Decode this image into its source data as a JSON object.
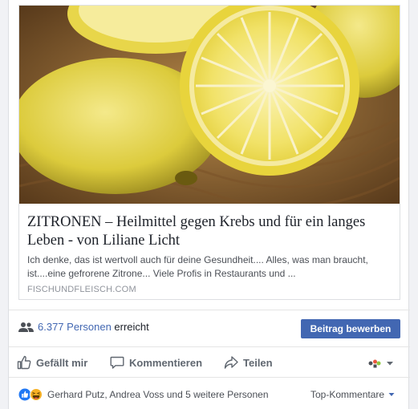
{
  "link_preview": {
    "title": "ZITRONEN – Heilmittel gegen Krebs und für ein langes Leben - von Liliane Licht",
    "description": "Ich denke, das ist wertvoll auch für deine Gesundheit.... Alles, was man braucht, ist....eine gefrorene Zitrone... Viele Profis in Restaurants und ...",
    "domain": "FISCHUNDFLEISCH.COM"
  },
  "reach": {
    "count": "6.377 Personen",
    "suffix": " erreicht",
    "promote_label": "Beitrag bewerben"
  },
  "actions": {
    "like": "Gefällt mir",
    "comment": "Kommentieren",
    "share": "Teilen"
  },
  "likes": {
    "names": "Gerhard Putz, Andrea Voss und 5 weitere Personen",
    "sort_label": "Top-Kommentare"
  },
  "colors": {
    "brand": "#4267b2",
    "like_blue": "#2078f4",
    "haha_yellow": "#f7b125"
  },
  "icons": [
    "people-icon",
    "like-icon",
    "comment-icon",
    "share-icon",
    "audience-icon",
    "chevron-down-icon",
    "like-reaction-icon",
    "haha-reaction-icon"
  ]
}
